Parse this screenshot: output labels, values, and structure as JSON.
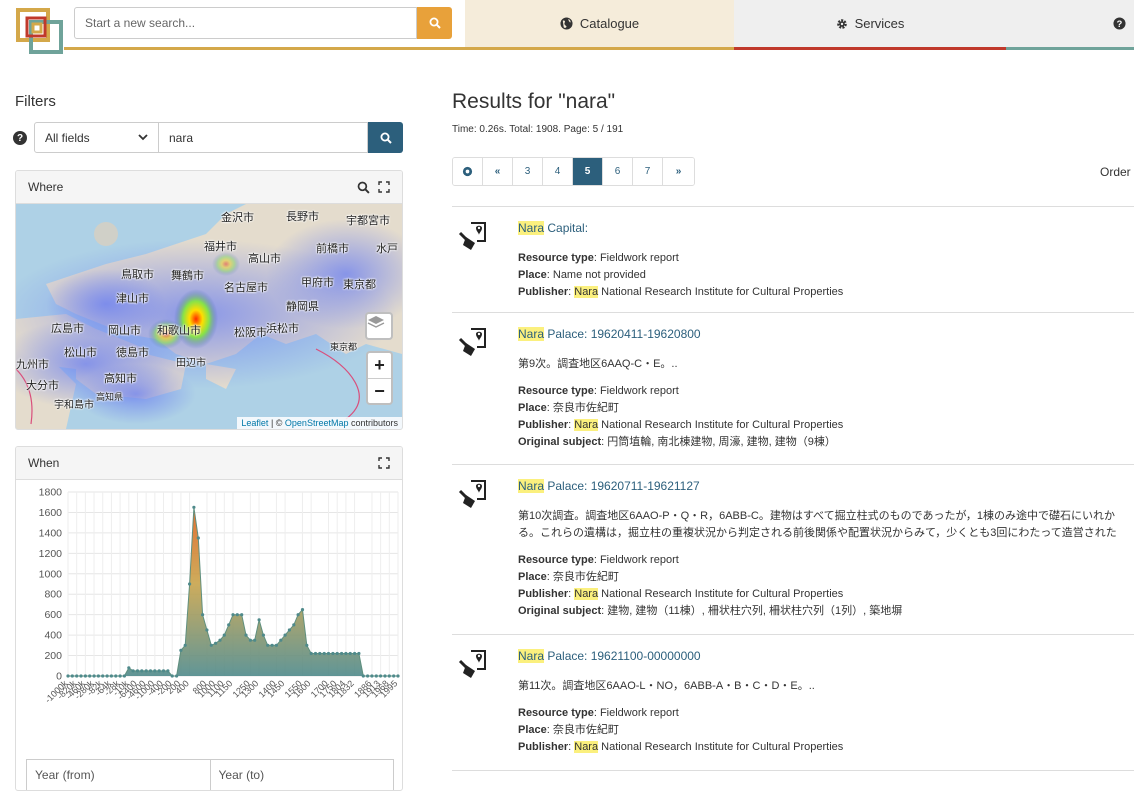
{
  "header": {
    "search_placeholder": "Start a new search...",
    "nav": [
      {
        "label": "Catalogue",
        "icon": "globe-icon"
      },
      {
        "label": "Services",
        "icon": "gear-icon"
      },
      {
        "label": "",
        "icon": "question-circle-icon"
      }
    ],
    "colors": {
      "search_button": "#e8a13a",
      "catalogue_accent": "#d4a84a",
      "services_accent": "#c0392b",
      "help_accent": "#6fa39a"
    }
  },
  "filters": {
    "title": "Filters",
    "field_select": "All fields",
    "query": "nara",
    "where": {
      "title": "Where",
      "map_labels": [
        "金沢市",
        "長野市",
        "宇都宮市",
        "福井市",
        "高山市",
        "前橋市",
        "水戸",
        "鳥取市",
        "舞鶴市",
        "名古屋市",
        "甲府市",
        "東京都",
        "津山市",
        "静岡県",
        "岡山市",
        "広島市",
        "和歌山市",
        "松阪市",
        "浜松市",
        "東京都",
        "松山市",
        "徳島市",
        "田辺市",
        "九州市",
        "高知市",
        "大分市",
        "宇和島市",
        "高知県"
      ],
      "attribution_link1": "Leaflet",
      "attribution_sep": " | © ",
      "attribution_link2": "OpenStreetMap",
      "attribution_rest": " contributors"
    },
    "when": {
      "title": "When",
      "year_from_placeholder": "Year (from)",
      "year_to_placeholder": "Year (to)"
    }
  },
  "results": {
    "title": "Results for \"nara\"",
    "meta": "Time: 0.26s. Total: 1908. Page: 5 / 191",
    "order_label": "Order",
    "pager": [
      {
        "label": "⟲",
        "type": "reset"
      },
      {
        "label": "«",
        "type": "nav"
      },
      {
        "label": "3",
        "type": "page"
      },
      {
        "label": "4",
        "type": "page"
      },
      {
        "label": "5",
        "type": "active"
      },
      {
        "label": "6",
        "type": "page"
      },
      {
        "label": "7",
        "type": "page"
      },
      {
        "label": "»",
        "type": "nav"
      }
    ],
    "labels": {
      "resource_type": "Resource type",
      "place": "Place",
      "publisher": "Publisher",
      "original_subject": "Original subject"
    },
    "items": [
      {
        "title_hl": "Nara",
        "title_rest": " Capital:",
        "desc": [],
        "resource_type": "Fieldwork report",
        "place": "Name not provided",
        "publisher_hl": "Nara",
        "publisher_rest": " National Research Institute for Cultural Properties",
        "original_subject": ""
      },
      {
        "title_hl": "Nara",
        "title_rest": " Palace: 19620411-19620800",
        "desc": [
          "第9次。調査地区6AAQ-C・E。.."
        ],
        "resource_type": "Fieldwork report",
        "place": "奈良市佐紀町",
        "publisher_hl": "Nara",
        "publisher_rest": " National Research Institute for Cultural Properties",
        "original_subject": "円筒埴輪, 南北棟建物, 周濠, 建物, 建物（9棟）"
      },
      {
        "title_hl": "Nara",
        "title_rest": " Palace: 19620711-19621127",
        "desc": [
          "第10次調査。調査地区6AAO-P・Q・R，6ABB-C。建物はすべて掘立柱式のものであったが，1棟のみ途中で礎石にいれか",
          "る。これらの遺構は，掘立柱の重複状況から判定される前後関係や配置状況からみて，少くとも3回にわたって造営された"
        ],
        "resource_type": "Fieldwork report",
        "place": "奈良市佐紀町",
        "publisher_hl": "Nara",
        "publisher_rest": " National Research Institute for Cultural Properties",
        "original_subject": "建物, 建物（11棟）, 柵状柱穴列, 柵状柱穴列（1列）, 築地塀"
      },
      {
        "title_hl": "Nara",
        "title_rest": " Palace: 19621100-00000000",
        "desc": [
          "第11次。調査地区6AAO-L・NO，6ABB-A・B・C・D・E。.."
        ],
        "resource_type": "Fieldwork report",
        "place": "奈良市佐紀町",
        "publisher_hl": "Nara",
        "publisher_rest": " National Research Institute for Cultural Properties",
        "original_subject": ""
      }
    ]
  },
  "chart_data": {
    "type": "area",
    "x": [
      "-1000k",
      "-900k",
      "-820k",
      "-600k",
      "-460k",
      "-350k",
      "-280k",
      "-150k",
      "-82k",
      "-70k",
      "-64k",
      "-40k",
      "-28k",
      "-15k",
      "-10k",
      "-8000",
      "-6400",
      "-5000",
      "-4600",
      "-2000",
      "-1000",
      "-700",
      "-400",
      "-300",
      "-200",
      "0",
      "200",
      "300",
      "400",
      "500",
      "600",
      "700",
      "800",
      "900",
      "1000",
      "1050",
      "1100",
      "1125",
      "1150",
      "1175",
      "1200",
      "1225",
      "1250",
      "1275",
      "1300",
      "1325",
      "1350",
      "1375",
      "1400",
      "1425",
      "1450",
      "1475",
      "1500",
      "1525",
      "1550",
      "1575",
      "1600",
      "1625",
      "1650",
      "1675",
      "1700",
      "1725",
      "1750",
      "1775",
      "1804",
      "1813",
      "1832",
      "1850",
      "1868",
      "1882",
      "1886",
      "1900",
      "1913",
      "1940",
      "1968",
      "1980",
      "1995"
    ],
    "x_tick_labels": [
      "-1000k",
      "-820k",
      "-460k",
      "-280k",
      "-82k",
      "-64k",
      "-28k",
      "-10k",
      "-6400",
      "-4600",
      "-1000",
      "-400",
      "-200",
      "200",
      "400",
      "800",
      "1000",
      "1100",
      "1150",
      "1250",
      "1300",
      "1400",
      "1450",
      "1550",
      "1600",
      "1700",
      "1750",
      "1804",
      "1832",
      "1886",
      "1913",
      "1968",
      "1995"
    ],
    "values": [
      0,
      0,
      0,
      0,
      0,
      0,
      0,
      0,
      0,
      0,
      0,
      0,
      0,
      0,
      80,
      50,
      50,
      50,
      50,
      50,
      50,
      50,
      50,
      50,
      0,
      0,
      250,
      300,
      900,
      1650,
      1350,
      600,
      450,
      300,
      320,
      350,
      400,
      500,
      600,
      600,
      600,
      400,
      350,
      350,
      550,
      400,
      300,
      300,
      300,
      350,
      400,
      450,
      500,
      600,
      650,
      300,
      220,
      220,
      220,
      220,
      220,
      220,
      220,
      220,
      220,
      220,
      220,
      220,
      0,
      0,
      0,
      0,
      0,
      0,
      0,
      0,
      0
    ],
    "ylim": [
      0,
      1800
    ],
    "yticks": [
      0,
      200,
      400,
      600,
      800,
      1000,
      1200,
      1400,
      1600,
      1800
    ],
    "grid": true,
    "legend": "none"
  }
}
